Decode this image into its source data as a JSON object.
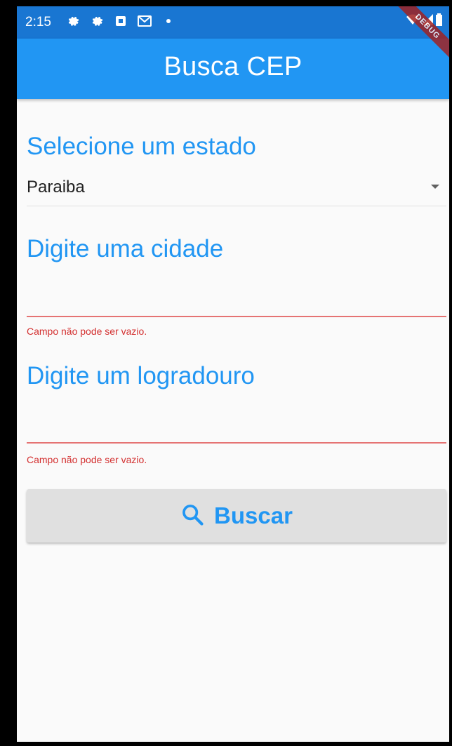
{
  "status_bar": {
    "time": "2:15",
    "icons": [
      "gear-icon",
      "gear-icon",
      "badge-icon",
      "mail-icon",
      "dot-icon"
    ],
    "right_icons": [
      "wifi-icon",
      "signal-icon",
      "battery-icon"
    ]
  },
  "app_bar": {
    "title": "Busca CEP",
    "debug_label": "DEBUG"
  },
  "form": {
    "state_label": "Selecione um estado",
    "state_value": "Paraiba",
    "city_label": "Digite uma cidade",
    "city_value": "",
    "city_error": "Campo não pode ser vazio.",
    "street_label": "Digite um logradouro",
    "street_value": "",
    "street_error": "Campo não pode ser vazio.",
    "search_button_label": "Buscar",
    "search_button_icon": "search-icon"
  },
  "colors": {
    "primary": "#2196f3",
    "primary_dark": "#1976d2",
    "error": "#d32f2f",
    "button_bg": "#e0e0e0"
  }
}
